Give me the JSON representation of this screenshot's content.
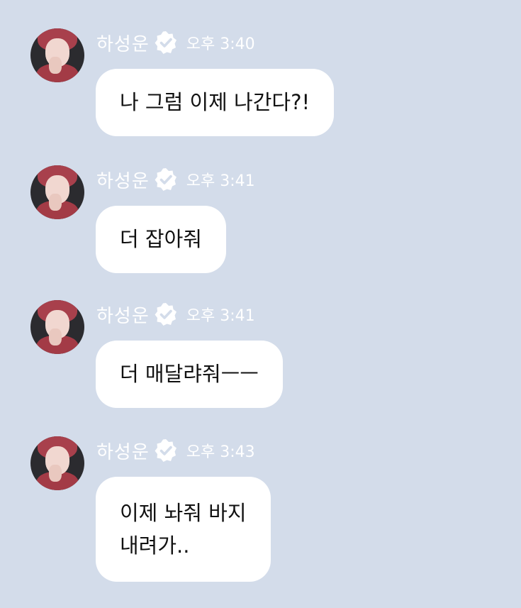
{
  "colors": {
    "background": "#d3dcea",
    "bubble": "#ffffff",
    "meta_text": "#ffffff",
    "message_text": "#111111"
  },
  "messages": [
    {
      "sender": "하성운",
      "verified_icon": "verified-badge-icon",
      "time": "오후 3:40",
      "text": "나 그럼 이제 나간다?!"
    },
    {
      "sender": "하성운",
      "verified_icon": "verified-badge-icon",
      "time": "오후 3:41",
      "text": "더 잡아줘"
    },
    {
      "sender": "하성운",
      "verified_icon": "verified-badge-icon",
      "time": "오후 3:41",
      "text": "더 매달랴줘ㅡㅡ"
    },
    {
      "sender": "하성운",
      "verified_icon": "verified-badge-icon",
      "time": "오후 3:43",
      "text_lines": [
        "이제 놔줘 바지",
        "내려가.."
      ]
    }
  ]
}
